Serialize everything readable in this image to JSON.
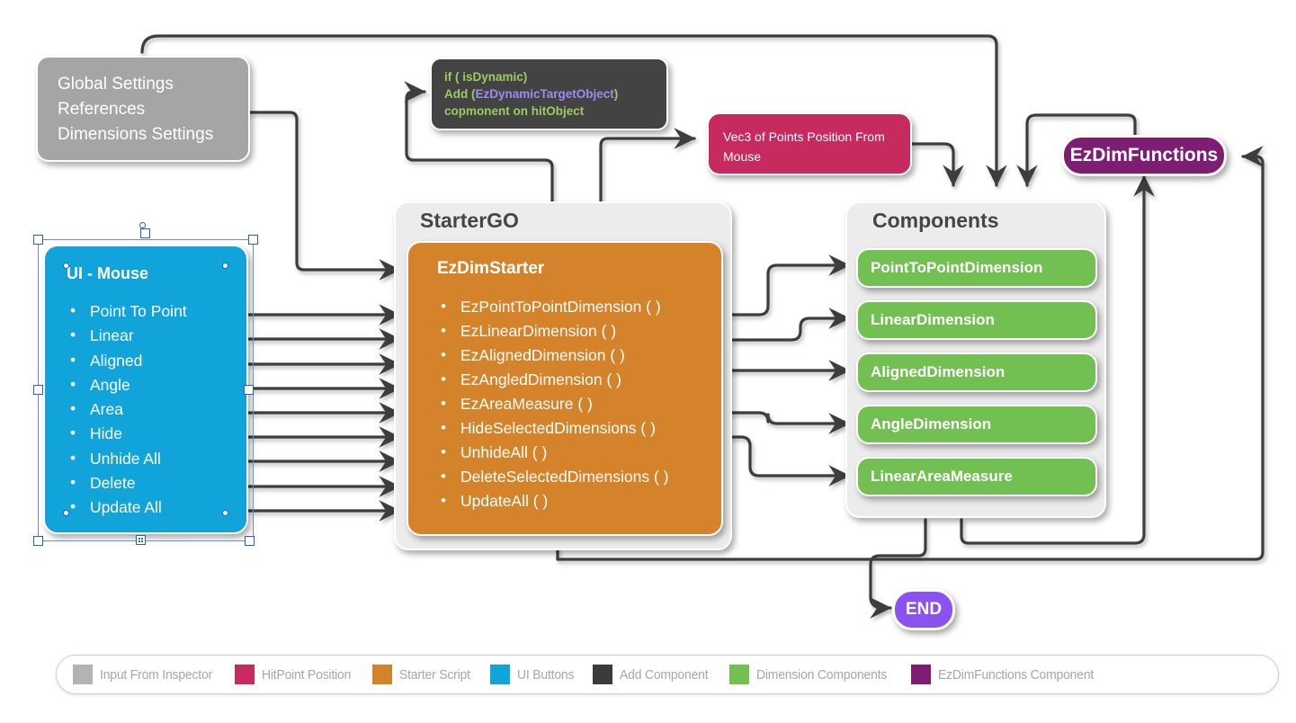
{
  "nodes": {
    "inspector": {
      "lines": [
        "Global Settings",
        "References",
        "Dimensions Settings"
      ],
      "color": "#a5a5a5"
    },
    "code": {
      "line1": "if ( isDynamic)",
      "line2_a": "Add (",
      "line2_b": "EzDynamicTargetObject",
      "line2_c": ")",
      "line3": "copmonent on hitObject",
      "color": "#434343",
      "text_color": "#9ccb5f",
      "highlight_color": "#9c8cf0"
    },
    "hitpoint": {
      "text": "Vec3 of Points Position From Mouse",
      "color": "#c72a5e"
    },
    "ezdimfunctions": {
      "label": "EzDimFunctions",
      "color": "#7d1d74"
    },
    "end": {
      "label": "END",
      "color": "#8c52f0"
    },
    "ui_mouse": {
      "title": "UI - Mouse",
      "color": "#10a4db",
      "items": [
        "Point To Point",
        "Linear",
        "Aligned",
        "Angle",
        "Area",
        "Hide",
        "Unhide All",
        "Delete",
        "Update All"
      ]
    },
    "startergo": {
      "panel_title": "StarterGO",
      "script_title": "EzDimStarter",
      "color": "#d5832a",
      "methods": [
        "EzPointToPointDimension ( )",
        "EzLinearDimension ( )",
        "EzAlignedDimension ( )",
        "EzAngledDimension ( )",
        "EzAreaMeasure ( )",
        "HideSelectedDimensions ( )",
        "UnhideAll ( )",
        "DeleteSelectedDimensions ( )",
        "UpdateAll ( )"
      ]
    },
    "components": {
      "panel_title": "Components",
      "color": "#72bf52",
      "items": [
        "PointToPointDimension",
        "LinearDimension",
        "AlignedDimension",
        "AngleDimension",
        "LinearAreaMeasure"
      ]
    }
  },
  "legend": {
    "items": [
      {
        "label": "Input From Inspector",
        "color": "#b3b3b3"
      },
      {
        "label": "HitPoint Position",
        "color": "#c72a5e"
      },
      {
        "label": "Starter Script",
        "color": "#d5832a"
      },
      {
        "label": "UI Buttons",
        "color": "#10a4db"
      },
      {
        "label": "Add Component",
        "color": "#3b3b3b"
      },
      {
        "label": "Dimension Components",
        "color": "#72bf52"
      },
      {
        "label": "EzDimFunctions Component",
        "color": "#7d1d74"
      }
    ]
  }
}
